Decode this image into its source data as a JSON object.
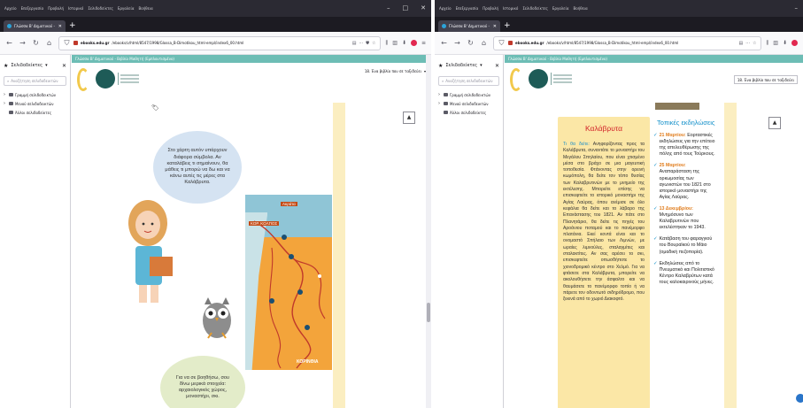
{
  "browser": {
    "menu": [
      "Αρχείο",
      "Επεξεργασία",
      "Προβολή",
      "Ιστορικό",
      "Σελιδοδείκτες",
      "Εργαλεία",
      "Βοήθεια"
    ],
    "tab_title": "Γλώσσα Β' Δημοτικού - 18. Έ",
    "url_bold": "ebooks.edu.gr",
    "url_rest": "/ebooks/v/html/8547/1998/Glossa_B-Dimotikou_html-empl/index6_00.html",
    "window_controls": [
      "–",
      "□",
      "✕"
    ]
  },
  "sidebar": {
    "title": "Σελιδοδείκτες",
    "search_placeholder": "Αναζήτηση σελιδοδεικτών",
    "items": [
      {
        "label": "Γραμμή σελιδοδεικτών",
        "kind": "folder-expandable"
      },
      {
        "label": "Μενού σελιδοδεικτών",
        "kind": "folder-expandable"
      },
      {
        "label": "Άλλοι σελιδοδείκτες",
        "kind": "folder"
      }
    ]
  },
  "book": {
    "bar_text": "Γλώσσα Β' Δημοτικού - Βιβλίο Μαθητή (Εμπλουτισμένο)",
    "chapter": "18. Ένα βιβλίο που σε ταξιδεύει"
  },
  "left_page": {
    "bubble_top": "Στο χάρτη αυτόν υπάρχουν διάφορα σύμβολα. Αν καταλάβεις τι σημαίνουν, θα μάθεις τι μπορώ να δω και να κάνω αυτές τις μέρες στα Καλάβρυτα.",
    "bubble_bottom": "Για να σε βοηθήσω, σου δίνω μερικά στοιχεία: αρχαιολογικός χώρος, μοναστήρι, σκι.",
    "map_label_top": "Ακράτα",
    "map_label_gulf": "ΚΟΡ. ΚΟΛΠΟΣ",
    "map_label_bottom": "ΚΟΡΙΝΘΙΑ",
    "page_icon": "🏷"
  },
  "right_page": {
    "title": "Καλάβρυτα",
    "body_label": "Τι θα δείτε:",
    "body": "Ανηφορίζοντας προς τα Καλάβρυτα, συναντάτε το μοναστήρι του Μεγάλου Σπηλαίου, που είναι χτισμένο μέσα στο βράχο σε μια μαγευτική τοποθεσία. Φτάνοντας στην ορεινή κωμόπολη, θα δείτε τον τόπο θυσίας των Καλαβρυτινών με το μνημείο της εκτέλεσης. Μπορείτε επίσης να επισκεφτείτε το ιστορικό μοναστήρι της Αγίας Λαύρας, όπου ανέμισε σε όλο κεφάλια θα δείτε και το λάβαρο της Επανάστασης του 1821. Αν πάτε στο Πλανητάριο, θα δείτε τις πηγές του Αροάνιου ποταμού και το πανέμορφο πλατάνια. Εκεί κοντά είναι και το ονομαστό Σπήλαιο των Λιμνών, με ωραίες λιμνούλες, σταλαγμίτες και σταλακτίτες. Αν σας αρέσει το σκι, επισκεφτείτε οπωσδήποτε το χιονοδρομικό κέντρο στο Χελμό. Για να φτάσετε στα Καλάβρυτα, μπορείτε να ακολουθήσετε την άσφαλτο και να θαυμάσετε το πανέμορφο τοπίο ή να πάρετε τον οδοντωτό σιδηρόδρομο, που ξεκινά από το χωριό Διακοφτό.",
    "events_title": "Τοπικές εκδηλώσεις",
    "events": [
      {
        "date": "21 Μαρτίου:",
        "text": "Εορταστικές εκδηλώσεις για την επέτειο της απελευθέρωσης της πόλης από τους Τούρκους."
      },
      {
        "date": "25 Μαρτίου:",
        "text": "Αναπαράσταση της ορκωμοσίας των αγωνιστών του 1821 στο ιστορικό μοναστήρι της Αγίας Λαύρας."
      },
      {
        "date": "13 Δεκεμβρίου:",
        "text": "Μνημόσυνο των Καλαβρυτινών που εκτελέστηκαν το 1943."
      },
      {
        "date": "",
        "text": "Κατάβαση του φαραγγιού του Βουραϊκού το Μάιο (ομαδική πεζοπορία)."
      },
      {
        "date": "",
        "text": "Εκδηλώσεις από το Πνευματικό και Πολιτιστικό Κέντρο Καλαβρύτων κατά τους καλοκαιρινούς μήνες."
      }
    ]
  }
}
